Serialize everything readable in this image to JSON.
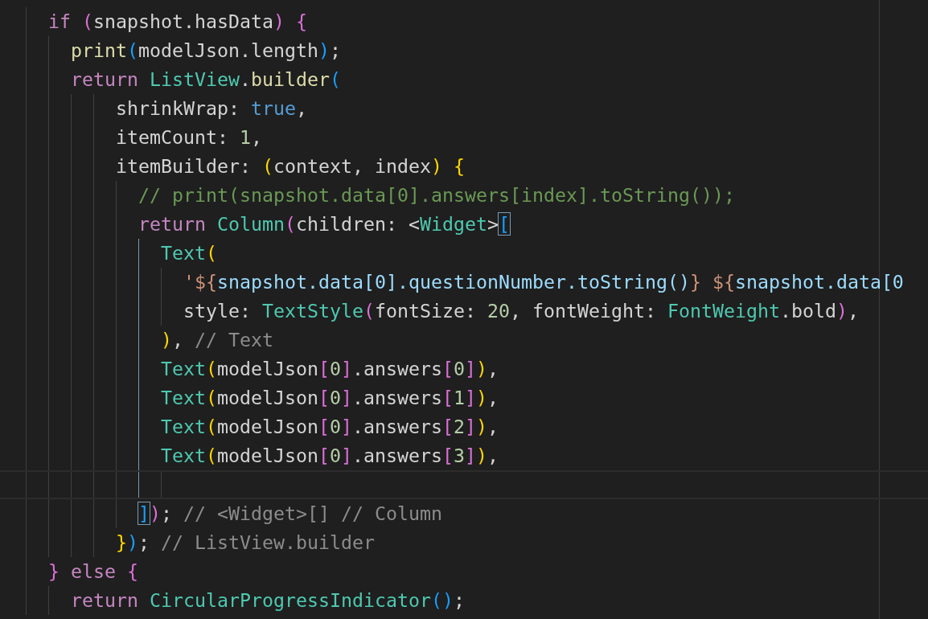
{
  "editor": {
    "lines": [
      {
        "current": false,
        "tokens": [
          {
            "kind": "kw",
            "text": "    if"
          },
          {
            "kind": "b2",
            "text": " ("
          },
          {
            "kind": "id",
            "text": "snapshot.hasData"
          },
          {
            "kind": "b2",
            "text": ")"
          },
          {
            "kind": "b2",
            "text": " {"
          }
        ]
      },
      {
        "current": false,
        "tokens": [
          {
            "kind": "fn",
            "text": "      print"
          },
          {
            "kind": "b3",
            "text": "("
          },
          {
            "kind": "id",
            "text": "modelJson.length"
          },
          {
            "kind": "b3",
            "text": ")"
          },
          {
            "kind": "id",
            "text": ";"
          }
        ]
      },
      {
        "current": false,
        "tokens": [
          {
            "kind": "kw",
            "text": "      return"
          },
          {
            "kind": "type",
            "text": " ListView"
          },
          {
            "kind": "id",
            "text": "."
          },
          {
            "kind": "fn",
            "text": "builder"
          },
          {
            "kind": "b3",
            "text": "("
          }
        ]
      },
      {
        "current": false,
        "tokens": [
          {
            "kind": "id",
            "text": "          shrinkWrap: "
          },
          {
            "kind": "bool",
            "text": "true"
          },
          {
            "kind": "id",
            "text": ","
          }
        ]
      },
      {
        "current": false,
        "tokens": [
          {
            "kind": "id",
            "text": "          itemCount: "
          },
          {
            "kind": "num",
            "text": "1"
          },
          {
            "kind": "id",
            "text": ","
          }
        ]
      },
      {
        "current": false,
        "tokens": [
          {
            "kind": "id",
            "text": "          itemBuilder: "
          },
          {
            "kind": "b1",
            "text": "("
          },
          {
            "kind": "id",
            "text": "context, index"
          },
          {
            "kind": "b1",
            "text": ")"
          },
          {
            "kind": "b1",
            "text": " {"
          }
        ]
      },
      {
        "current": false,
        "tokens": [
          {
            "kind": "comment",
            "text": "            // print(snapshot.data[0].answers[index].toString());"
          }
        ]
      },
      {
        "current": false,
        "tokens": [
          {
            "kind": "kw",
            "text": "            return"
          },
          {
            "kind": "type",
            "text": " Column"
          },
          {
            "kind": "b2",
            "text": "("
          },
          {
            "kind": "id",
            "text": "children: <"
          },
          {
            "kind": "type",
            "text": "Widget"
          },
          {
            "kind": "id",
            "text": ">"
          },
          {
            "kind": "match",
            "text": "["
          }
        ]
      },
      {
        "current": false,
        "tokens": [
          {
            "kind": "type",
            "text": "              Text"
          },
          {
            "kind": "b1",
            "text": "("
          }
        ]
      },
      {
        "current": false,
        "tokens": [
          {
            "kind": "str",
            "text": "                '${"
          },
          {
            "kind": "var",
            "text": "snapshot.data[0].questionNumber.toString()"
          },
          {
            "kind": "str",
            "text": "}"
          },
          {
            "kind": "str",
            "text": " ${"
          },
          {
            "kind": "var",
            "text": "snapshot.data[0"
          }
        ]
      },
      {
        "current": false,
        "tokens": [
          {
            "kind": "id",
            "text": "                style: "
          },
          {
            "kind": "type",
            "text": "TextStyle"
          },
          {
            "kind": "b2",
            "text": "("
          },
          {
            "kind": "id",
            "text": "fontSize: "
          },
          {
            "kind": "num",
            "text": "20"
          },
          {
            "kind": "id",
            "text": ", fontWeight: "
          },
          {
            "kind": "type",
            "text": "FontWeight"
          },
          {
            "kind": "id",
            "text": ".bold"
          },
          {
            "kind": "b2",
            "text": ")"
          },
          {
            "kind": "id",
            "text": ","
          }
        ]
      },
      {
        "current": false,
        "tokens": [
          {
            "kind": "b1",
            "text": "              )"
          },
          {
            "kind": "id",
            "text": ", "
          },
          {
            "kind": "hint",
            "text": "// Text"
          }
        ]
      },
      {
        "current": false,
        "tokens": [
          {
            "kind": "type",
            "text": "              Text"
          },
          {
            "kind": "b1",
            "text": "("
          },
          {
            "kind": "id",
            "text": "modelJson"
          },
          {
            "kind": "b2",
            "text": "["
          },
          {
            "kind": "num",
            "text": "0"
          },
          {
            "kind": "b2",
            "text": "]"
          },
          {
            "kind": "id",
            "text": ".answers"
          },
          {
            "kind": "b2",
            "text": "["
          },
          {
            "kind": "num",
            "text": "0"
          },
          {
            "kind": "b2",
            "text": "]"
          },
          {
            "kind": "b1",
            "text": ")"
          },
          {
            "kind": "id",
            "text": ","
          }
        ]
      },
      {
        "current": false,
        "tokens": [
          {
            "kind": "type",
            "text": "              Text"
          },
          {
            "kind": "b1",
            "text": "("
          },
          {
            "kind": "id",
            "text": "modelJson"
          },
          {
            "kind": "b2",
            "text": "["
          },
          {
            "kind": "num",
            "text": "0"
          },
          {
            "kind": "b2",
            "text": "]"
          },
          {
            "kind": "id",
            "text": ".answers"
          },
          {
            "kind": "b2",
            "text": "["
          },
          {
            "kind": "num",
            "text": "1"
          },
          {
            "kind": "b2",
            "text": "]"
          },
          {
            "kind": "b1",
            "text": ")"
          },
          {
            "kind": "id",
            "text": ","
          }
        ]
      },
      {
        "current": false,
        "tokens": [
          {
            "kind": "type",
            "text": "              Text"
          },
          {
            "kind": "b1",
            "text": "("
          },
          {
            "kind": "id",
            "text": "modelJson"
          },
          {
            "kind": "b2",
            "text": "["
          },
          {
            "kind": "num",
            "text": "0"
          },
          {
            "kind": "b2",
            "text": "]"
          },
          {
            "kind": "id",
            "text": ".answers"
          },
          {
            "kind": "b2",
            "text": "["
          },
          {
            "kind": "num",
            "text": "2"
          },
          {
            "kind": "b2",
            "text": "]"
          },
          {
            "kind": "b1",
            "text": ")"
          },
          {
            "kind": "id",
            "text": ","
          }
        ]
      },
      {
        "current": false,
        "tokens": [
          {
            "kind": "type",
            "text": "              Text"
          },
          {
            "kind": "b1",
            "text": "("
          },
          {
            "kind": "id",
            "text": "modelJson"
          },
          {
            "kind": "b2",
            "text": "["
          },
          {
            "kind": "num",
            "text": "0"
          },
          {
            "kind": "b2",
            "text": "]"
          },
          {
            "kind": "id",
            "text": ".answers"
          },
          {
            "kind": "b2",
            "text": "["
          },
          {
            "kind": "num",
            "text": "3"
          },
          {
            "kind": "b2",
            "text": "]"
          },
          {
            "kind": "b1",
            "text": ")"
          },
          {
            "kind": "id",
            "text": ","
          }
        ]
      },
      {
        "current": true
      },
      {
        "current": false,
        "tokens": [
          {
            "kind": "match",
            "text": "            ]"
          },
          {
            "kind": "b2",
            "text": ")"
          },
          {
            "kind": "id",
            "text": "; "
          },
          {
            "kind": "hint",
            "text": "// <Widget>[] // Column"
          }
        ]
      },
      {
        "current": false,
        "tokens": [
          {
            "kind": "b1",
            "text": "          }"
          },
          {
            "kind": "b3",
            "text": ")"
          },
          {
            "kind": "id",
            "text": "; "
          },
          {
            "kind": "hint",
            "text": "// ListView.builder"
          }
        ]
      },
      {
        "current": false,
        "tokens": [
          {
            "kind": "b2",
            "text": "    }"
          },
          {
            "kind": "kw",
            "text": " else"
          },
          {
            "kind": "b2",
            "text": " {"
          }
        ]
      },
      {
        "current": false,
        "tokens": [
          {
            "kind": "kw",
            "text": "      return"
          },
          {
            "kind": "type",
            "text": " CircularProgressIndicator"
          },
          {
            "kind": "b3",
            "text": "()"
          },
          {
            "kind": "id",
            "text": ";"
          }
        ]
      }
    ]
  }
}
